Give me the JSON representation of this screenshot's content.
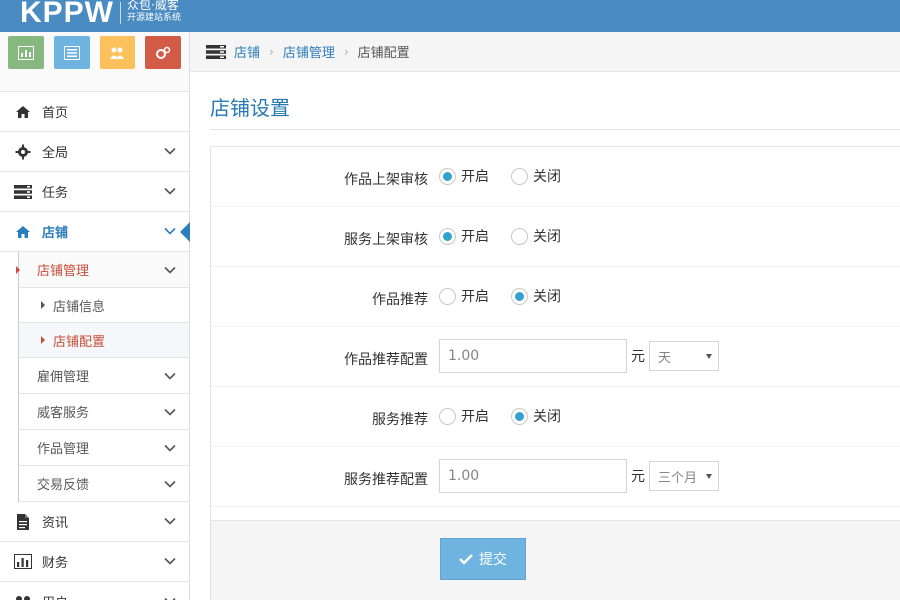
{
  "brand": {
    "logo_text": "KPPW",
    "tagline_line1": "众包·威客",
    "tagline_line2": "开源建站系统"
  },
  "shortcuts": [
    {
      "icon": "bar-chart-icon",
      "color": "#87b87f"
    },
    {
      "icon": "list-icon",
      "color": "#6fb3e0"
    },
    {
      "icon": "users-icon",
      "color": "#fcc15c"
    },
    {
      "icon": "cogs-icon",
      "color": "#d15b47"
    }
  ],
  "sidebar": {
    "items": [
      {
        "label": "首页",
        "icon": "home-icon"
      },
      {
        "label": "全局",
        "icon": "gear-icon"
      },
      {
        "label": "任务",
        "icon": "tasks-icon"
      },
      {
        "label": "店铺",
        "icon": "home-icon",
        "active": true
      }
    ],
    "shop_sub": {
      "open_label": "店铺管理",
      "children": [
        "店铺信息",
        "店铺配置"
      ],
      "others": [
        "雇佣管理",
        "威客服务",
        "作品管理",
        "交易反馈"
      ]
    },
    "bottom_items": [
      {
        "label": "资讯",
        "icon": "file-icon"
      },
      {
        "label": "财务",
        "icon": "bar-chart-icon"
      },
      {
        "label": "用户",
        "icon": "users-icon"
      }
    ]
  },
  "breadcrumb": {
    "items": [
      "店铺",
      "店铺管理"
    ],
    "current": "店铺配置"
  },
  "page": {
    "title": "店铺设置"
  },
  "form": {
    "rows": [
      {
        "label": "作品上架审核",
        "type": "radio",
        "options": [
          "开启",
          "关闭"
        ],
        "selected": "开启"
      },
      {
        "label": "服务上架审核",
        "type": "radio",
        "options": [
          "开启",
          "关闭"
        ],
        "selected": "开启"
      },
      {
        "label": "作品推荐",
        "type": "radio",
        "options": [
          "开启",
          "关闭"
        ],
        "selected": "关闭"
      },
      {
        "label": "作品推荐配置",
        "type": "price",
        "value": "1.00",
        "unit": "元",
        "period": "天"
      },
      {
        "label": "服务推荐",
        "type": "radio",
        "options": [
          "开启",
          "关闭"
        ],
        "selected": "关闭"
      },
      {
        "label": "服务推荐配置",
        "type": "price",
        "value": "1.00",
        "unit": "元",
        "period": "三个月"
      }
    ],
    "submit_label": "提交"
  },
  "colors": {
    "topbar": "#4a8bc2",
    "accent": "#2b7dbc",
    "active_sub": "#c84d3a",
    "button": "#6fb3e0"
  }
}
